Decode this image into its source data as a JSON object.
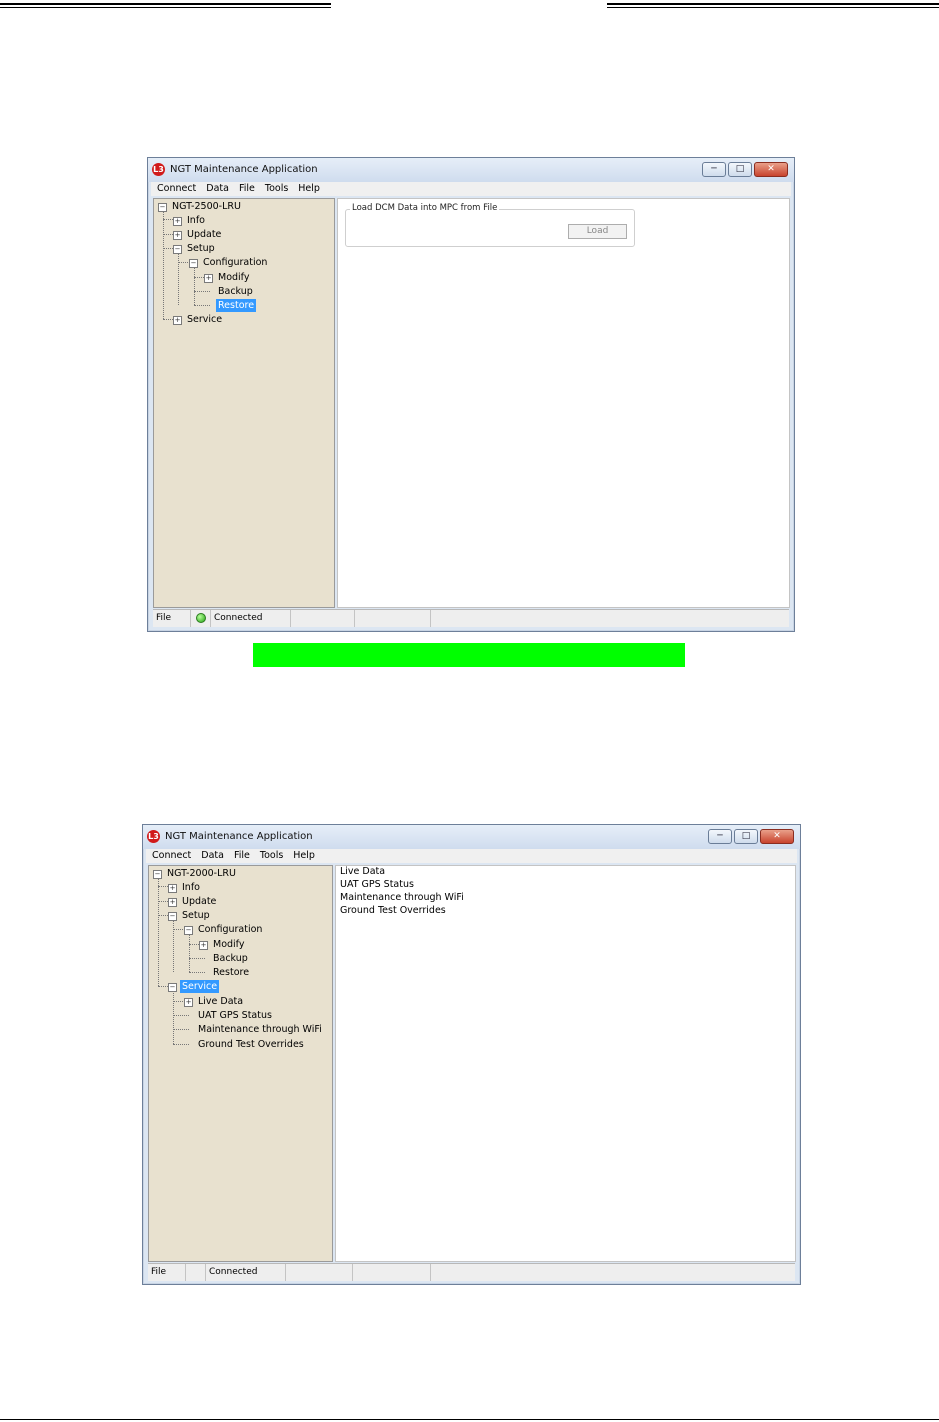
{
  "window1": {
    "title": "NGT Maintenance Application",
    "logo": "L3",
    "menu": [
      "Connect",
      "Data",
      "File",
      "Tools",
      "Help"
    ],
    "tree": {
      "root": "NGT-2500-LRU",
      "info": "Info",
      "update": "Update",
      "setup": "Setup",
      "configuration": "Configuration",
      "modify": "Modify",
      "backup": "Backup",
      "restore": "Restore",
      "service": "Service"
    },
    "groupbox_title": "Load DCM Data into MPC from File",
    "load_button": "Load",
    "status": {
      "file": "File",
      "connection": "Connected",
      "indicator_color": "#23a312"
    }
  },
  "window2": {
    "title": "NGT Maintenance Application",
    "logo": "L3",
    "menu": [
      "Connect",
      "Data",
      "File",
      "Tools",
      "Help"
    ],
    "tree": {
      "root": "NGT-2000-LRU",
      "info": "Info",
      "update": "Update",
      "setup": "Setup",
      "configuration": "Configuration",
      "modify": "Modify",
      "backup": "Backup",
      "restore": "Restore",
      "service": "Service",
      "live_data": "Live Data",
      "uat_gps": "UAT GPS Status",
      "wifi": "Maintenance through WiFi",
      "ground_test": "Ground Test Overrides"
    },
    "content_items": [
      "Live Data",
      "UAT GPS Status",
      "Maintenance through WiFi",
      "Ground Test Overrides"
    ],
    "status": {
      "file": "File",
      "connection": "Connected"
    }
  },
  "colors": {
    "highlight": "#00ff00",
    "selection": "#3399ff"
  }
}
